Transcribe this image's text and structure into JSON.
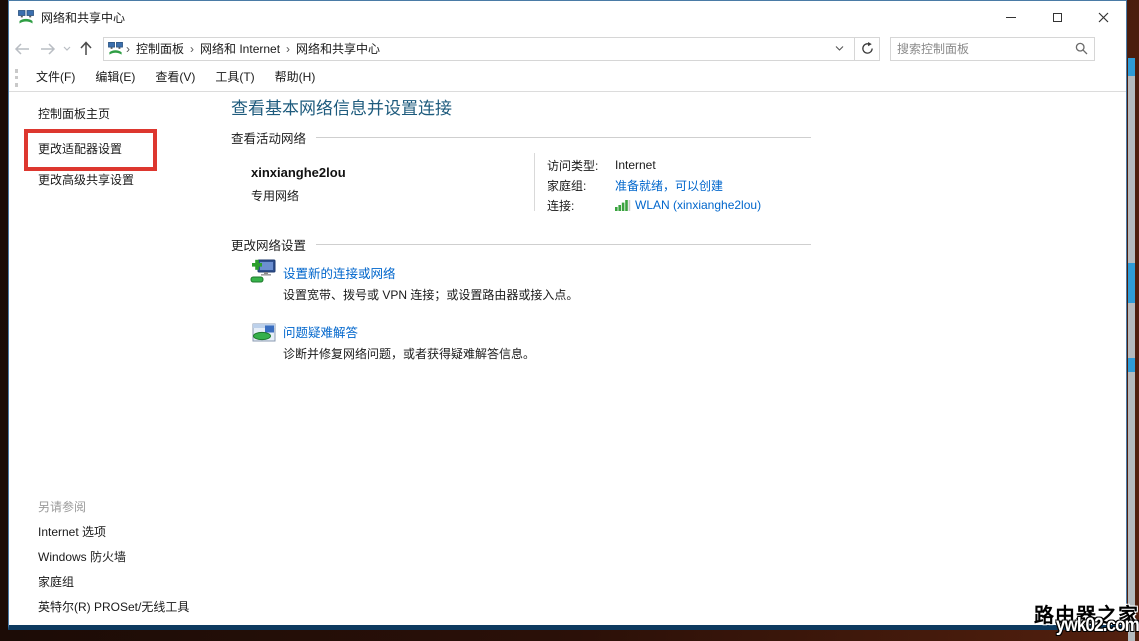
{
  "window": {
    "title": "网络和共享中心"
  },
  "toolbar": {
    "breadcrumb": [
      "控制面板",
      "网络和 Internet",
      "网络和共享中心"
    ],
    "search_placeholder": "搜索控制面板"
  },
  "menu": {
    "items": [
      "文件(F)",
      "编辑(E)",
      "查看(V)",
      "工具(T)",
      "帮助(H)"
    ]
  },
  "sidebar": {
    "items": [
      {
        "label": "控制面板主页",
        "highlighted": false
      },
      {
        "label": "更改适配器设置",
        "highlighted": true
      },
      {
        "label": "更改高级共享设置",
        "highlighted": false
      }
    ]
  },
  "main": {
    "title": "查看基本网络信息并设置连接",
    "sections": {
      "active": "查看活动网络",
      "change": "更改网络设置"
    },
    "network": {
      "name": "xinxianghe2lou",
      "type": "专用网络",
      "access_label": "访问类型:",
      "access_value": "Internet",
      "homegroup_label": "家庭组:",
      "homegroup_value": "准备就绪，可以创建",
      "connection_label": "连接:",
      "connection_value": "WLAN (xinxianghe2lou)"
    },
    "tasks": [
      {
        "title": "设置新的连接或网络",
        "desc": "设置宽带、拨号或 VPN 连接；或设置路由器或接入点。"
      },
      {
        "title": "问题疑难解答",
        "desc": "诊断并修复网络问题，或者获得疑难解答信息。"
      }
    ]
  },
  "see_also": {
    "header": "另请参阅",
    "links": [
      "Internet 选项",
      "Windows 防火墙",
      "家庭组",
      "英特尔(R) PROSet/无线工具"
    ]
  },
  "watermark": {
    "line1": "路由器之家",
    "line2": "ywk02.com"
  },
  "icons": {
    "breadcrumb_separator": "›"
  },
  "colors": {
    "link_blue": "#0066cc",
    "heading_blue": "#1e5b7d",
    "highlight_red": "#dd372f",
    "wifi_green": "#3aa33f"
  }
}
